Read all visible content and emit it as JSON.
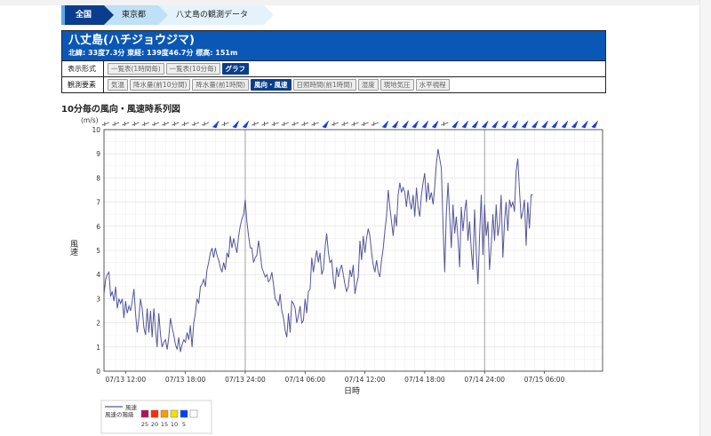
{
  "breadcrumb": [
    "全国",
    "東京都",
    "八丈島の観測データ"
  ],
  "station": {
    "name": "八丈島(ハチジョウジマ)",
    "meta": "北緯: 33度7.3分 東経: 139度46.7分 標高: 151m"
  },
  "display_format": {
    "label": "表示形式",
    "options": [
      "一覧表(1時間毎)",
      "一覧表(10分毎)",
      "グラフ"
    ],
    "selected": "グラフ"
  },
  "elements": {
    "label": "観測要素",
    "options": [
      "気温",
      "降水量(前10分間)",
      "降水量(前1時間)",
      "風向・風速",
      "日照時間(前1時間)",
      "湿度",
      "現地気圧",
      "水平視程"
    ],
    "selected": "風向・風速"
  },
  "section_title": "10分毎の風向・風速時系列図",
  "colors": {
    "line": "#55559a",
    "accent": "#0a57b5",
    "arrow": "#1a3fcf"
  },
  "chart_data": {
    "type": "line",
    "title": "10分毎の風向・風速時系列図",
    "ylabel": "風速",
    "yunit": "(m/s)",
    "xlabel": "日時",
    "ylim": [
      0,
      10
    ],
    "yticks": [
      0,
      1,
      2,
      3,
      4,
      5,
      6,
      7,
      8,
      9,
      10
    ],
    "xlim": [
      "07/13 09:50",
      "07/15 11:50"
    ],
    "xticks": [
      "07/13 12:00",
      "07/13 18:00",
      "07/13 24:00",
      "07/14 06:00",
      "07/14 12:00",
      "07/14 18:00",
      "07/14 24:00",
      "07/15 06:00"
    ],
    "grid": true,
    "series": [
      {
        "name": "風速",
        "start": "07/13 09:50",
        "step_minutes": 10,
        "values": [
          3.2,
          3.8,
          4.0,
          4.1,
          3.1,
          3.3,
          2.9,
          3.5,
          2.6,
          3.0,
          2.8,
          3.0,
          2.2,
          2.9,
          2.4,
          2.7,
          2.5,
          2.9,
          3.4,
          2.4,
          1.6,
          2.2,
          3.0,
          2.6,
          1.8,
          1.5,
          2.6,
          1.6,
          2.5,
          1.4,
          2.6,
          1.7,
          1.0,
          2.4,
          1.5,
          1.0,
          1.2,
          1.3,
          0.9,
          1.4,
          2.2,
          1.8,
          1.5,
          1.1,
          0.9,
          1.4,
          0.8,
          1.1,
          1.3,
          1.2,
          1.6,
          1.3,
          1.9,
          1.0,
          2.0,
          2.4,
          3.0,
          2.8,
          3.5,
          3.6,
          3.8,
          3.5,
          4.2,
          4.5,
          4.9,
          5.1,
          4.7,
          5.1,
          4.8,
          4.6,
          4.3,
          4.1,
          4.5,
          4.2,
          4.9,
          4.7,
          5.6,
          5.1,
          5.5,
          5.2,
          4.9,
          5.6,
          6.0,
          6.3,
          6.5,
          7.1,
          6.2,
          5.6,
          5.1,
          5.1,
          4.5,
          4.7,
          4.8,
          5.4,
          4.9,
          4.3,
          4.1,
          3.9,
          4.0,
          3.7,
          3.8,
          4.1,
          3.6,
          3.0,
          2.9,
          2.7,
          3.2,
          2.5,
          2.2,
          1.7,
          1.4,
          2.4,
          1.6,
          2.9,
          2.8,
          2.6,
          2.0,
          2.3,
          2.7,
          2.0,
          2.1,
          3.0,
          2.4,
          3.3,
          3.4,
          4.7,
          4.1,
          4.6,
          5.0,
          4.5,
          4.9,
          4.0,
          4.2,
          5.1,
          5.7,
          4.9,
          4.5,
          4.6,
          3.8,
          3.4,
          4.3,
          3.9,
          4.2,
          4.4,
          4.0,
          3.6,
          3.3,
          3.5,
          4.2,
          3.9,
          4.4,
          3.2,
          3.6,
          3.9,
          5.4,
          4.6,
          5.6,
          4.9,
          5.5,
          5.9,
          5.6,
          4.9,
          4.4,
          4.1,
          4.6,
          4.1,
          3.9,
          4.6,
          5.1,
          5.8,
          6.4,
          7.5,
          6.8,
          6.2,
          5.6,
          6.5,
          6.0,
          7.3,
          7.8,
          7.4,
          7.6,
          7.4,
          6.8,
          7.5,
          7.0,
          6.7,
          7.3,
          6.4,
          7.6,
          6.8,
          6.4,
          7.3,
          7.8,
          8.2,
          7.0,
          7.8,
          7.1,
          7.4,
          6.9,
          7.6,
          8.6,
          9.2,
          8.8,
          8.4,
          6.0,
          4.1,
          6.5,
          7.8,
          6.4,
          5.1,
          6.9,
          5.7,
          6.4,
          5.5,
          4.3,
          6.8,
          5.8,
          6.6,
          7.1,
          5.4,
          6.2,
          5.0,
          4.2,
          6.7,
          4.9,
          3.6,
          5.6,
          7.3,
          4.8,
          6.9,
          5.6,
          6.2,
          4.2,
          5.2,
          6.5,
          5.4,
          6.9,
          5.6,
          6.1,
          7.3,
          4.7,
          6.2,
          7.0,
          5.8,
          7.1,
          6.8,
          7.0,
          6.6,
          8.3,
          8.8,
          7.5,
          6.3,
          6.6,
          7.1,
          5.2,
          7.0,
          5.9,
          7.3,
          7.3
        ]
      }
    ],
    "legend": {
      "series_label": "風速",
      "rank_label": "風速の階級",
      "ranks": [
        {
          "value": "25",
          "color": "#b0105e"
        },
        {
          "value": "20",
          "color": "#ff2a00"
        },
        {
          "value": "15",
          "color": "#ff9900"
        },
        {
          "value": "10",
          "color": "#f2e100"
        },
        {
          "value": "5",
          "color": "#0041ff"
        },
        {
          "value": "",
          "color": "#ffffff"
        }
      ]
    }
  }
}
